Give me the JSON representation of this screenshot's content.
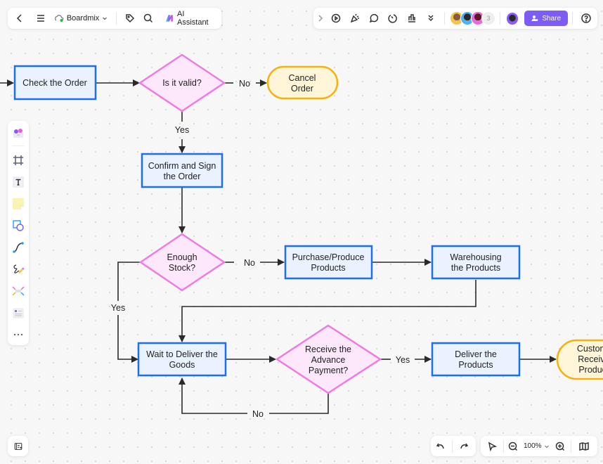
{
  "topbar": {
    "brand_name": "Boardmix",
    "ai_assistant_label": "AI Assistant",
    "collaborator_extra_count": "3",
    "share_label": "Share",
    "left_icons": [
      "back-icon",
      "menu-icon",
      "cloud-icon",
      "tag-icon",
      "search-icon",
      "ai-logo-icon"
    ],
    "right_icons": [
      "expand-icon",
      "present-icon",
      "celebrate-icon",
      "comment-icon",
      "timer-icon",
      "vote-icon",
      "more-chevrons-icon",
      "help-icon"
    ],
    "collaborators": [
      {
        "name": "collaborator-1",
        "color": "#f3c24f"
      },
      {
        "name": "collaborator-2",
        "color": "#4fb0f3"
      },
      {
        "name": "collaborator-3",
        "color": "#e96ad6"
      }
    ],
    "current_user_color": "#8a5cf5",
    "accent_color": "#7c5cf5"
  },
  "toolbar": {
    "tools": [
      {
        "id": "templates",
        "label": "Templates"
      },
      {
        "id": "frame",
        "label": "Frame"
      },
      {
        "id": "text",
        "label": "Text"
      },
      {
        "id": "sticky-note",
        "label": "Sticky Note"
      },
      {
        "id": "shape",
        "label": "Shape"
      },
      {
        "id": "connector",
        "label": "Connector"
      },
      {
        "id": "pen",
        "label": "Pen"
      },
      {
        "id": "mindmap",
        "label": "Mind Map"
      },
      {
        "id": "table",
        "label": "Table"
      },
      {
        "id": "more",
        "label": "More"
      }
    ]
  },
  "bottombar": {
    "zoom_level": "100%"
  },
  "flowchart": {
    "colors": {
      "process_fill": "#eaf1ff",
      "process_stroke": "#1e6ff0",
      "decision_fill": "#fde8fb",
      "decision_stroke": "#f07ae0",
      "terminal_fill": "#fff6da",
      "terminal_stroke": "#f5b20f",
      "edge": "#2a2a2a"
    },
    "nodes": {
      "check_order": {
        "type": "process",
        "lines": [
          "Check the Order"
        ]
      },
      "is_valid": {
        "type": "decision",
        "lines": [
          "Is it valid?"
        ]
      },
      "cancel_order": {
        "type": "terminal",
        "lines": [
          "Cancel",
          "Order"
        ]
      },
      "confirm_sign": {
        "type": "process",
        "lines": [
          "Confirm and Sign",
          "the Order"
        ]
      },
      "enough_stock": {
        "type": "decision",
        "lines": [
          "Enough",
          "Stock?"
        ]
      },
      "purchase_produce": {
        "type": "process",
        "lines": [
          "Purchase/Produce",
          "Products"
        ]
      },
      "warehousing": {
        "type": "process",
        "lines": [
          "Warehousing",
          "the Products"
        ]
      },
      "wait_deliver": {
        "type": "process",
        "lines": [
          "Wait to Deliver the",
          "Goods"
        ]
      },
      "receive_payment": {
        "type": "decision",
        "lines": [
          "Receive the",
          "Advance",
          "Payment?"
        ]
      },
      "deliver_products": {
        "type": "process",
        "lines": [
          "Deliver the",
          "Products"
        ]
      },
      "customer_receives": {
        "type": "terminal",
        "lines": [
          "Customer",
          "Receives",
          "Products"
        ]
      }
    },
    "edge_labels": {
      "valid_no": "No",
      "valid_yes": "Yes",
      "stock_no": "No",
      "stock_yes": "Yes",
      "payment_yes": "Yes",
      "payment_no": "No"
    }
  }
}
